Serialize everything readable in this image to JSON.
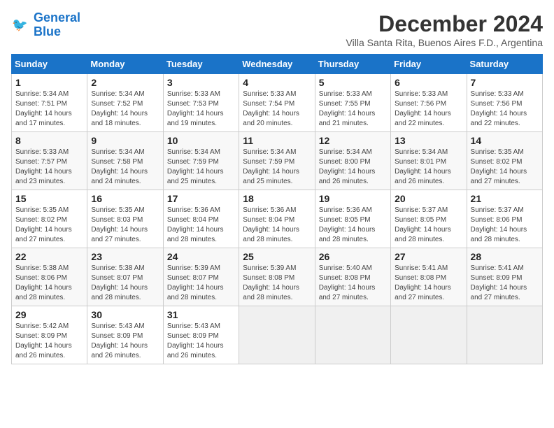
{
  "header": {
    "logo_line1": "General",
    "logo_line2": "Blue",
    "month_title": "December 2024",
    "subtitle": "Villa Santa Rita, Buenos Aires F.D., Argentina"
  },
  "days_of_week": [
    "Sunday",
    "Monday",
    "Tuesday",
    "Wednesday",
    "Thursday",
    "Friday",
    "Saturday"
  ],
  "weeks": [
    [
      {
        "day": "1",
        "sunrise": "Sunrise: 5:34 AM",
        "sunset": "Sunset: 7:51 PM",
        "daylight": "Daylight: 14 hours and 17 minutes."
      },
      {
        "day": "2",
        "sunrise": "Sunrise: 5:34 AM",
        "sunset": "Sunset: 7:52 PM",
        "daylight": "Daylight: 14 hours and 18 minutes."
      },
      {
        "day": "3",
        "sunrise": "Sunrise: 5:33 AM",
        "sunset": "Sunset: 7:53 PM",
        "daylight": "Daylight: 14 hours and 19 minutes."
      },
      {
        "day": "4",
        "sunrise": "Sunrise: 5:33 AM",
        "sunset": "Sunset: 7:54 PM",
        "daylight": "Daylight: 14 hours and 20 minutes."
      },
      {
        "day": "5",
        "sunrise": "Sunrise: 5:33 AM",
        "sunset": "Sunset: 7:55 PM",
        "daylight": "Daylight: 14 hours and 21 minutes."
      },
      {
        "day": "6",
        "sunrise": "Sunrise: 5:33 AM",
        "sunset": "Sunset: 7:56 PM",
        "daylight": "Daylight: 14 hours and 22 minutes."
      },
      {
        "day": "7",
        "sunrise": "Sunrise: 5:33 AM",
        "sunset": "Sunset: 7:56 PM",
        "daylight": "Daylight: 14 hours and 22 minutes."
      }
    ],
    [
      {
        "day": "8",
        "sunrise": "Sunrise: 5:33 AM",
        "sunset": "Sunset: 7:57 PM",
        "daylight": "Daylight: 14 hours and 23 minutes."
      },
      {
        "day": "9",
        "sunrise": "Sunrise: 5:34 AM",
        "sunset": "Sunset: 7:58 PM",
        "daylight": "Daylight: 14 hours and 24 minutes."
      },
      {
        "day": "10",
        "sunrise": "Sunrise: 5:34 AM",
        "sunset": "Sunset: 7:59 PM",
        "daylight": "Daylight: 14 hours and 25 minutes."
      },
      {
        "day": "11",
        "sunrise": "Sunrise: 5:34 AM",
        "sunset": "Sunset: 7:59 PM",
        "daylight": "Daylight: 14 hours and 25 minutes."
      },
      {
        "day": "12",
        "sunrise": "Sunrise: 5:34 AM",
        "sunset": "Sunset: 8:00 PM",
        "daylight": "Daylight: 14 hours and 26 minutes."
      },
      {
        "day": "13",
        "sunrise": "Sunrise: 5:34 AM",
        "sunset": "Sunset: 8:01 PM",
        "daylight": "Daylight: 14 hours and 26 minutes."
      },
      {
        "day": "14",
        "sunrise": "Sunrise: 5:35 AM",
        "sunset": "Sunset: 8:02 PM",
        "daylight": "Daylight: 14 hours and 27 minutes."
      }
    ],
    [
      {
        "day": "15",
        "sunrise": "Sunrise: 5:35 AM",
        "sunset": "Sunset: 8:02 PM",
        "daylight": "Daylight: 14 hours and 27 minutes."
      },
      {
        "day": "16",
        "sunrise": "Sunrise: 5:35 AM",
        "sunset": "Sunset: 8:03 PM",
        "daylight": "Daylight: 14 hours and 27 minutes."
      },
      {
        "day": "17",
        "sunrise": "Sunrise: 5:36 AM",
        "sunset": "Sunset: 8:04 PM",
        "daylight": "Daylight: 14 hours and 28 minutes."
      },
      {
        "day": "18",
        "sunrise": "Sunrise: 5:36 AM",
        "sunset": "Sunset: 8:04 PM",
        "daylight": "Daylight: 14 hours and 28 minutes."
      },
      {
        "day": "19",
        "sunrise": "Sunrise: 5:36 AM",
        "sunset": "Sunset: 8:05 PM",
        "daylight": "Daylight: 14 hours and 28 minutes."
      },
      {
        "day": "20",
        "sunrise": "Sunrise: 5:37 AM",
        "sunset": "Sunset: 8:05 PM",
        "daylight": "Daylight: 14 hours and 28 minutes."
      },
      {
        "day": "21",
        "sunrise": "Sunrise: 5:37 AM",
        "sunset": "Sunset: 8:06 PM",
        "daylight": "Daylight: 14 hours and 28 minutes."
      }
    ],
    [
      {
        "day": "22",
        "sunrise": "Sunrise: 5:38 AM",
        "sunset": "Sunset: 8:06 PM",
        "daylight": "Daylight: 14 hours and 28 minutes."
      },
      {
        "day": "23",
        "sunrise": "Sunrise: 5:38 AM",
        "sunset": "Sunset: 8:07 PM",
        "daylight": "Daylight: 14 hours and 28 minutes."
      },
      {
        "day": "24",
        "sunrise": "Sunrise: 5:39 AM",
        "sunset": "Sunset: 8:07 PM",
        "daylight": "Daylight: 14 hours and 28 minutes."
      },
      {
        "day": "25",
        "sunrise": "Sunrise: 5:39 AM",
        "sunset": "Sunset: 8:08 PM",
        "daylight": "Daylight: 14 hours and 28 minutes."
      },
      {
        "day": "26",
        "sunrise": "Sunrise: 5:40 AM",
        "sunset": "Sunset: 8:08 PM",
        "daylight": "Daylight: 14 hours and 27 minutes."
      },
      {
        "day": "27",
        "sunrise": "Sunrise: 5:41 AM",
        "sunset": "Sunset: 8:08 PM",
        "daylight": "Daylight: 14 hours and 27 minutes."
      },
      {
        "day": "28",
        "sunrise": "Sunrise: 5:41 AM",
        "sunset": "Sunset: 8:09 PM",
        "daylight": "Daylight: 14 hours and 27 minutes."
      }
    ],
    [
      {
        "day": "29",
        "sunrise": "Sunrise: 5:42 AM",
        "sunset": "Sunset: 8:09 PM",
        "daylight": "Daylight: 14 hours and 26 minutes."
      },
      {
        "day": "30",
        "sunrise": "Sunrise: 5:43 AM",
        "sunset": "Sunset: 8:09 PM",
        "daylight": "Daylight: 14 hours and 26 minutes."
      },
      {
        "day": "31",
        "sunrise": "Sunrise: 5:43 AM",
        "sunset": "Sunset: 8:09 PM",
        "daylight": "Daylight: 14 hours and 26 minutes."
      },
      null,
      null,
      null,
      null
    ]
  ]
}
